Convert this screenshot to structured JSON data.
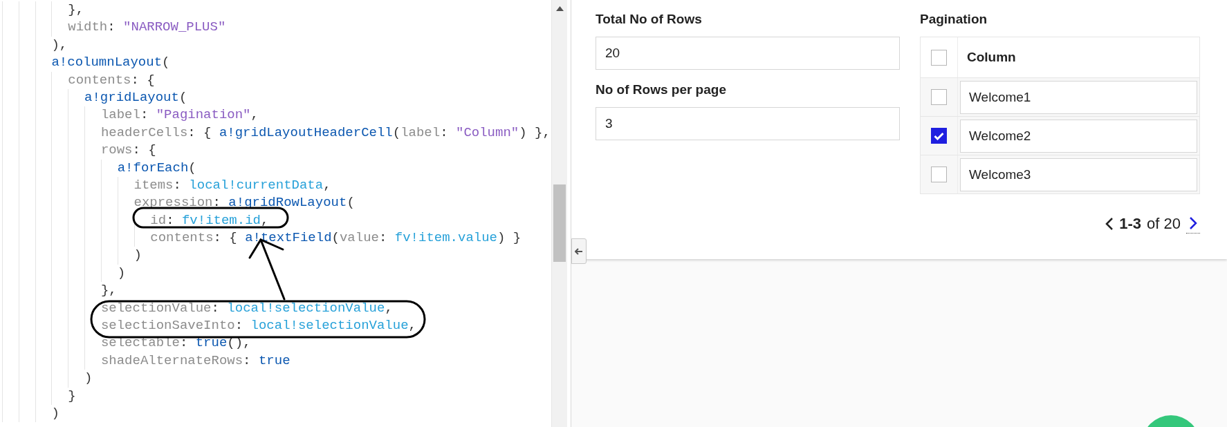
{
  "code_editor": {
    "lines": [
      {
        "tokens": [
          {
            "kind": "punct",
            "text": "        },"
          }
        ]
      },
      {
        "tokens": [
          {
            "kind": "key",
            "text": "        width"
          },
          {
            "kind": "punct",
            "text": ": "
          },
          {
            "kind": "string",
            "text": "\"NARROW_PLUS\""
          }
        ]
      },
      {
        "tokens": [
          {
            "kind": "punct",
            "text": "      ),"
          }
        ]
      },
      {
        "tokens": [
          {
            "kind": "func",
            "text": "      a!columnLayout"
          },
          {
            "kind": "punct",
            "text": "("
          }
        ]
      },
      {
        "tokens": [
          {
            "kind": "key",
            "text": "        contents"
          },
          {
            "kind": "punct",
            "text": ": {"
          }
        ]
      },
      {
        "tokens": [
          {
            "kind": "func",
            "text": "          a!gridLayout"
          },
          {
            "kind": "punct",
            "text": "("
          }
        ]
      },
      {
        "tokens": [
          {
            "kind": "key",
            "text": "            label"
          },
          {
            "kind": "punct",
            "text": ": "
          },
          {
            "kind": "string",
            "text": "\"Pagination\""
          },
          {
            "kind": "punct",
            "text": ","
          }
        ]
      },
      {
        "tokens": [
          {
            "kind": "key",
            "text": "            headerCells"
          },
          {
            "kind": "punct",
            "text": ": { "
          },
          {
            "kind": "func",
            "text": "a!gridLayoutHeaderCell"
          },
          {
            "kind": "punct",
            "text": "("
          },
          {
            "kind": "key",
            "text": "label"
          },
          {
            "kind": "punct",
            "text": ": "
          },
          {
            "kind": "string",
            "text": "\"Column\""
          },
          {
            "kind": "punct",
            "text": ") },"
          }
        ]
      },
      {
        "tokens": [
          {
            "kind": "key",
            "text": "            rows"
          },
          {
            "kind": "punct",
            "text": ": {"
          }
        ]
      },
      {
        "tokens": [
          {
            "kind": "func",
            "text": "              a!forEach"
          },
          {
            "kind": "punct",
            "text": "("
          }
        ]
      },
      {
        "tokens": [
          {
            "kind": "key",
            "text": "                items"
          },
          {
            "kind": "punct",
            "text": ": "
          },
          {
            "kind": "var",
            "text": "local!currentData"
          },
          {
            "kind": "punct",
            "text": ","
          }
        ]
      },
      {
        "tokens": [
          {
            "kind": "key",
            "text": "                expression"
          },
          {
            "kind": "punct",
            "text": ": "
          },
          {
            "kind": "func",
            "text": "a!gridRowLayout"
          },
          {
            "kind": "punct",
            "text": "("
          }
        ]
      },
      {
        "tokens": [
          {
            "kind": "key",
            "text": "                  id"
          },
          {
            "kind": "punct",
            "text": ": "
          },
          {
            "kind": "var",
            "text": "fv!item.id"
          },
          {
            "kind": "punct",
            "text": ","
          }
        ]
      },
      {
        "tokens": [
          {
            "kind": "key",
            "text": "                  contents"
          },
          {
            "kind": "punct",
            "text": ": { "
          },
          {
            "kind": "func",
            "text": "a!textField"
          },
          {
            "kind": "punct",
            "text": "("
          },
          {
            "kind": "key",
            "text": "value"
          },
          {
            "kind": "punct",
            "text": ": "
          },
          {
            "kind": "var",
            "text": "fv!item.value"
          },
          {
            "kind": "punct",
            "text": ") }"
          }
        ]
      },
      {
        "tokens": [
          {
            "kind": "punct",
            "text": "                )"
          }
        ]
      },
      {
        "tokens": [
          {
            "kind": "punct",
            "text": "              )"
          }
        ]
      },
      {
        "tokens": [
          {
            "kind": "punct",
            "text": "            },"
          }
        ]
      },
      {
        "tokens": [
          {
            "kind": "key",
            "text": "            selectionValue"
          },
          {
            "kind": "punct",
            "text": ": "
          },
          {
            "kind": "var",
            "text": "local!selectionValue"
          },
          {
            "kind": "punct",
            "text": ","
          }
        ]
      },
      {
        "tokens": [
          {
            "kind": "key",
            "text": "            selectionSaveInto"
          },
          {
            "kind": "punct",
            "text": ": "
          },
          {
            "kind": "var",
            "text": "local!selectionValue"
          },
          {
            "kind": "punct",
            "text": ","
          }
        ]
      },
      {
        "tokens": [
          {
            "kind": "key",
            "text": "            selectable"
          },
          {
            "kind": "punct",
            "text": ": "
          },
          {
            "kind": "keyword",
            "text": "true"
          },
          {
            "kind": "punct",
            "text": "(),"
          }
        ]
      },
      {
        "tokens": [
          {
            "kind": "key",
            "text": "            shadeAlternateRows"
          },
          {
            "kind": "punct",
            "text": ": "
          },
          {
            "kind": "keyword",
            "text": "true"
          }
        ]
      },
      {
        "tokens": [
          {
            "kind": "punct",
            "text": "          )"
          }
        ]
      },
      {
        "tokens": [
          {
            "kind": "punct",
            "text": "        }"
          }
        ]
      },
      {
        "tokens": [
          {
            "kind": "punct",
            "text": "      )"
          }
        ]
      }
    ]
  },
  "form": {
    "fields": [
      {
        "label": "Total No of Rows",
        "value": "20"
      },
      {
        "label": "No of Rows per page",
        "value": "3"
      }
    ]
  },
  "grid": {
    "label": "Pagination",
    "header_checked": false,
    "columns": [
      "Column"
    ],
    "rows": [
      {
        "value": "Welcome1",
        "checked": false
      },
      {
        "value": "Welcome2",
        "checked": true
      },
      {
        "value": "Welcome3",
        "checked": false
      }
    ],
    "pagination": {
      "range": "1-3",
      "of_total": "of 20"
    }
  }
}
